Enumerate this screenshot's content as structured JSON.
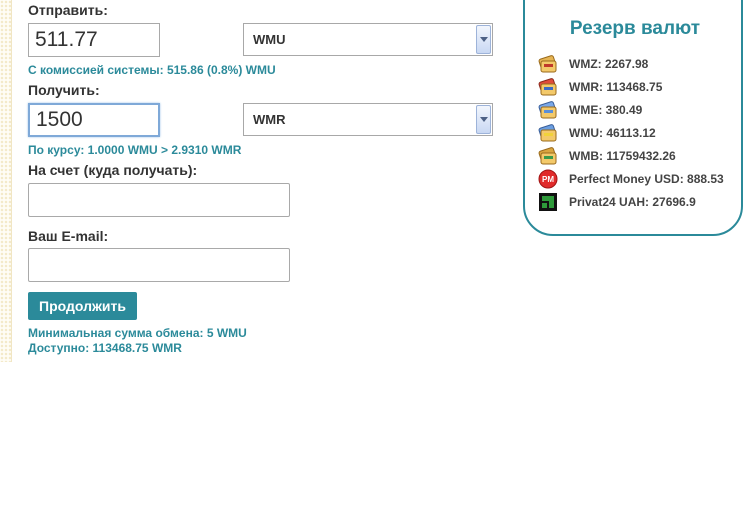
{
  "form": {
    "send_label": "Отправить:",
    "send_amount": "511.77",
    "send_currency": "WMU",
    "commission_note": "С комиссией системы: 515.86 (0.8%) WMU",
    "receive_label": "Получить:",
    "receive_amount": "1500",
    "receive_currency": "WMR",
    "rate_note": "По курсу: 1.0000 WMU > 2.9310 WMR",
    "account_label": "На счет (куда получать):",
    "account_value": "",
    "email_label": "Ваш E-mail:",
    "email_value": "",
    "continue_label": "Продолжить",
    "min_note": "Минимальная сумма обмена: 5 WMU",
    "available_note": "Доступно: 113468.75 WMR"
  },
  "reserves": {
    "title": "Резерв валют",
    "items": [
      {
        "label": "WMZ: 2267.98",
        "icon": "wallet-wmz-icon",
        "color": "#d8a03a"
      },
      {
        "label": "WMR: 113468.75",
        "icon": "wallet-wmr-icon",
        "color": "#4a78c8"
      },
      {
        "label": "WME: 380.49",
        "icon": "wallet-wme-icon",
        "color": "#6a9be0"
      },
      {
        "label": "WMU: 46113.12",
        "icon": "wallet-wmu-icon",
        "color": "#5c8fd8"
      },
      {
        "label": "WMB: 11759432.26",
        "icon": "wallet-wmb-icon",
        "color": "#d9a53f"
      },
      {
        "label": "Perfect Money USD: 888.53",
        "icon": "perfect-money-icon",
        "color": "#e02a2a"
      },
      {
        "label": "Privat24 UAH: 27696.9",
        "icon": "privat24-icon",
        "color": "#2e9a3a"
      }
    ]
  },
  "colors": {
    "accent": "#2b8a9a",
    "pm_red": "#e02a2a",
    "privat_green": "#2e9a3a"
  }
}
